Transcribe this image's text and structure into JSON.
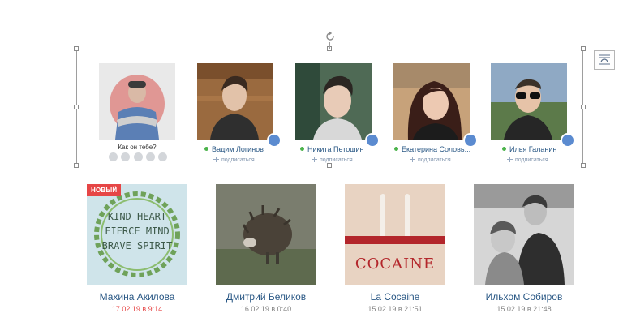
{
  "rating": {
    "question": "Как он тебе?",
    "stars": 5
  },
  "people": [
    {
      "name": "Вадим Логинов",
      "subscribe": "подписаться"
    },
    {
      "name": "Никита Петошин",
      "subscribe": "подписаться"
    },
    {
      "name": "Екатерина Соловь...",
      "subscribe": "подписаться"
    },
    {
      "name": "Илья Галанин",
      "subscribe": "подписаться"
    }
  ],
  "cards": [
    {
      "name": "Махина Акилова",
      "date": "17.02.19 в 9:14",
      "badge": "НОВЫЙ",
      "image_text": [
        "KIND HEART",
        "FIERCE MIND",
        "BRAVE SPIRIT"
      ]
    },
    {
      "name": "Дмитрий Беликов",
      "date": "16.02.19 в 0:40"
    },
    {
      "name": "La Cocaine",
      "date": "15.02.19 в 21:51",
      "image_text": [
        "COCAINE"
      ]
    },
    {
      "name": "Ильхом Собиров",
      "date": "15.02.19 в 21:48"
    }
  ],
  "colors": {
    "link": "#2a5885",
    "online": "#4bb34b",
    "badge": "#e64646",
    "heart": "#5b8bd0"
  }
}
